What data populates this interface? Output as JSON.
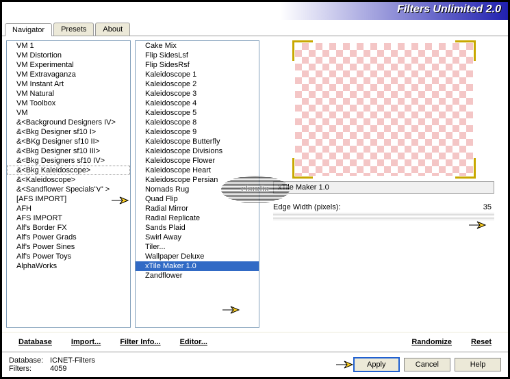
{
  "title": "Filters Unlimited 2.0",
  "tabs": [
    "Navigator",
    "Presets",
    "About"
  ],
  "active_tab": 0,
  "list1": [
    "VM 1",
    "VM Distortion",
    "VM Experimental",
    "VM Extravaganza",
    "VM Instant Art",
    "VM Natural",
    "VM Toolbox",
    "VM",
    "&<Background Designers IV>",
    "&<Bkg Designer sf10 I>",
    "&<BKg Designer sf10 II>",
    "&<Bkg Designer sf10 III>",
    "&<Bkg Designers sf10 IV>",
    "&<Bkg Kaleidoscope>",
    "&<Kaleidoscope>",
    "&<Sandflower Specials\"v\" >",
    "[AFS IMPORT]",
    "AFH",
    "AFS IMPORT",
    "Alf's Border FX",
    "Alf's Power Grads",
    "Alf's Power Sines",
    "Alf's Power Toys",
    "AlphaWorks"
  ],
  "list1_selected": 13,
  "list2": [
    "Cake Mix",
    "Flip SidesLsf",
    "Flip SidesRsf",
    "Kaleidoscope 1",
    "Kaleidoscope 2",
    "Kaleidoscope 3",
    "Kaleidoscope 4",
    "Kaleidoscope 5",
    "Kaleidoscope 8",
    "Kaleidoscope 9",
    "Kaleidoscope Butterfly",
    "Kaleidoscope Divisions",
    "Kaleidoscope Flower",
    "Kaleidoscope Heart",
    "Kaleidoscope Persian",
    "Nomads Rug",
    "Quad Flip",
    "Radial Mirror",
    "Radial Replicate",
    "Sands Plaid",
    "Swirl Away",
    "Tiler...",
    "Wallpaper Deluxe",
    "xTile Maker 1.0",
    "Zandflower"
  ],
  "list2_selected": 23,
  "filter_name": "xTile Maker 1.0",
  "param": {
    "label": "Edge Width (pixels):",
    "value": "35"
  },
  "btns": {
    "database": "Database",
    "import": "Import...",
    "filterinfo": "Filter Info...",
    "editor": "Editor...",
    "randomize": "Randomize",
    "reset": "Reset",
    "apply": "Apply",
    "cancel": "Cancel",
    "help": "Help"
  },
  "status": {
    "db_label": "Database:",
    "db_value": "ICNET-Filters",
    "filters_label": "Filters:",
    "filters_value": "4059"
  },
  "watermark": "claudia"
}
